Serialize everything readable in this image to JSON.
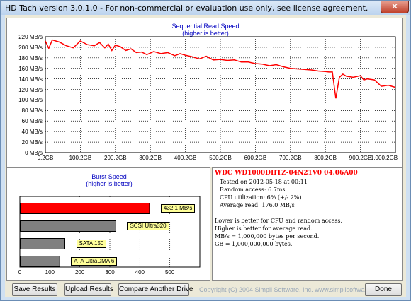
{
  "window": {
    "title": "HD Tach version 3.0.1.0  - For non-commercial or evaluation use only, see license agreement.",
    "close_glyph": "✕"
  },
  "seq_chart": {
    "title": "Sequential Read Speed",
    "subtitle": "(higher is better)",
    "y_ticks": [
      "220 MB/s",
      "200 MB/s",
      "180 MB/s",
      "160 MB/s",
      "140 MB/s",
      "120 MB/s",
      "100 MB/s",
      "80 MB/s",
      "60 MB/s",
      "40 MB/s",
      "20 MB/s",
      "0 MB/s"
    ],
    "x_ticks": [
      "0.2GB",
      "100.2GB",
      "200.2GB",
      "300.2GB",
      "400.2GB",
      "500.2GB",
      "600.2GB",
      "700.2GB",
      "800.2GB",
      "900.2GB",
      "1,000.2GB"
    ],
    "line_color": "#ff0000"
  },
  "chart_data": [
    {
      "type": "line",
      "title": "Sequential Read Speed",
      "subtitle": "(higher is better)",
      "ylim": [
        0,
        220
      ],
      "x_ticks": [
        "0.2GB",
        "100.2GB",
        "200.2GB",
        "300.2GB",
        "400.2GB",
        "500.2GB",
        "600.2GB",
        "700.2GB",
        "800.2GB",
        "900.2GB",
        "1,000.2GB"
      ],
      "grid": true,
      "x": [
        0.2,
        10,
        20,
        40,
        60,
        80,
        100,
        120,
        140,
        155,
        170,
        180,
        190,
        200,
        215,
        230,
        245,
        260,
        275,
        290,
        310,
        330,
        350,
        370,
        385,
        400,
        420,
        440,
        460,
        480,
        500,
        520,
        540,
        560,
        580,
        600,
        620,
        640,
        660,
        680,
        700,
        720,
        740,
        760,
        780,
        800,
        810,
        820,
        830,
        840,
        850,
        860,
        880,
        900,
        910,
        920,
        940,
        960,
        980,
        1000.2
      ],
      "values": [
        212,
        198,
        214,
        210,
        203,
        199,
        212,
        205,
        203,
        209,
        199,
        206,
        194,
        204,
        201,
        194,
        197,
        190,
        191,
        186,
        192,
        188,
        190,
        184,
        188,
        185,
        182,
        178,
        183,
        176,
        177,
        175,
        176,
        172,
        172,
        169,
        168,
        165,
        167,
        163,
        160,
        159,
        158,
        157,
        155,
        154,
        153,
        153,
        103,
        143,
        149,
        145,
        143,
        146,
        138,
        140,
        138,
        126,
        128,
        124
      ]
    },
    {
      "type": "bar",
      "title": "Burst Speed",
      "subtitle": "(higher is better)",
      "orientation": "horizontal",
      "categories": [
        "432.1 MB/s",
        "SCSI Ultra320",
        "SATA 150",
        "ATA UltraDMA 6"
      ],
      "values": [
        432.1,
        320,
        150,
        133
      ],
      "colors": [
        "#ff0000",
        "#808080",
        "#808080",
        "#808080"
      ],
      "x_ticks": [
        "0",
        "100",
        "200",
        "300",
        "400",
        "500"
      ],
      "xlim": [
        0,
        600
      ]
    }
  ],
  "burst": {
    "title": "Burst Speed",
    "subtitle": "(higher is better)",
    "x_ticks": [
      "0",
      "100",
      "200",
      "300",
      "400",
      "500"
    ]
  },
  "drive_info": {
    "model": "WDC WD1000DHTZ-04N21V0 04.06A00",
    "tested_on": "Tested on 2012-05-18 at 00:11",
    "random_access": "Random access: 6.7ms",
    "cpu": "CPU utilization: 6% (+/- 2%)",
    "avg_speed": "Average read: 176.0 MB/s",
    "note1": "Lower is better for CPU and random access.",
    "note2": "Higher is better for average read.",
    "note3": "MB/s = 1,000,000 bytes per second.",
    "note4": "GB = 1,000,000,000 bytes."
  },
  "buttons": {
    "save": "Save Results",
    "upload": "Upload Results",
    "compare": "Compare Another Drive",
    "done": "Done"
  },
  "copyright": "Copyright (C) 2004 Simpli Software, Inc. www.simplisoftware.com"
}
